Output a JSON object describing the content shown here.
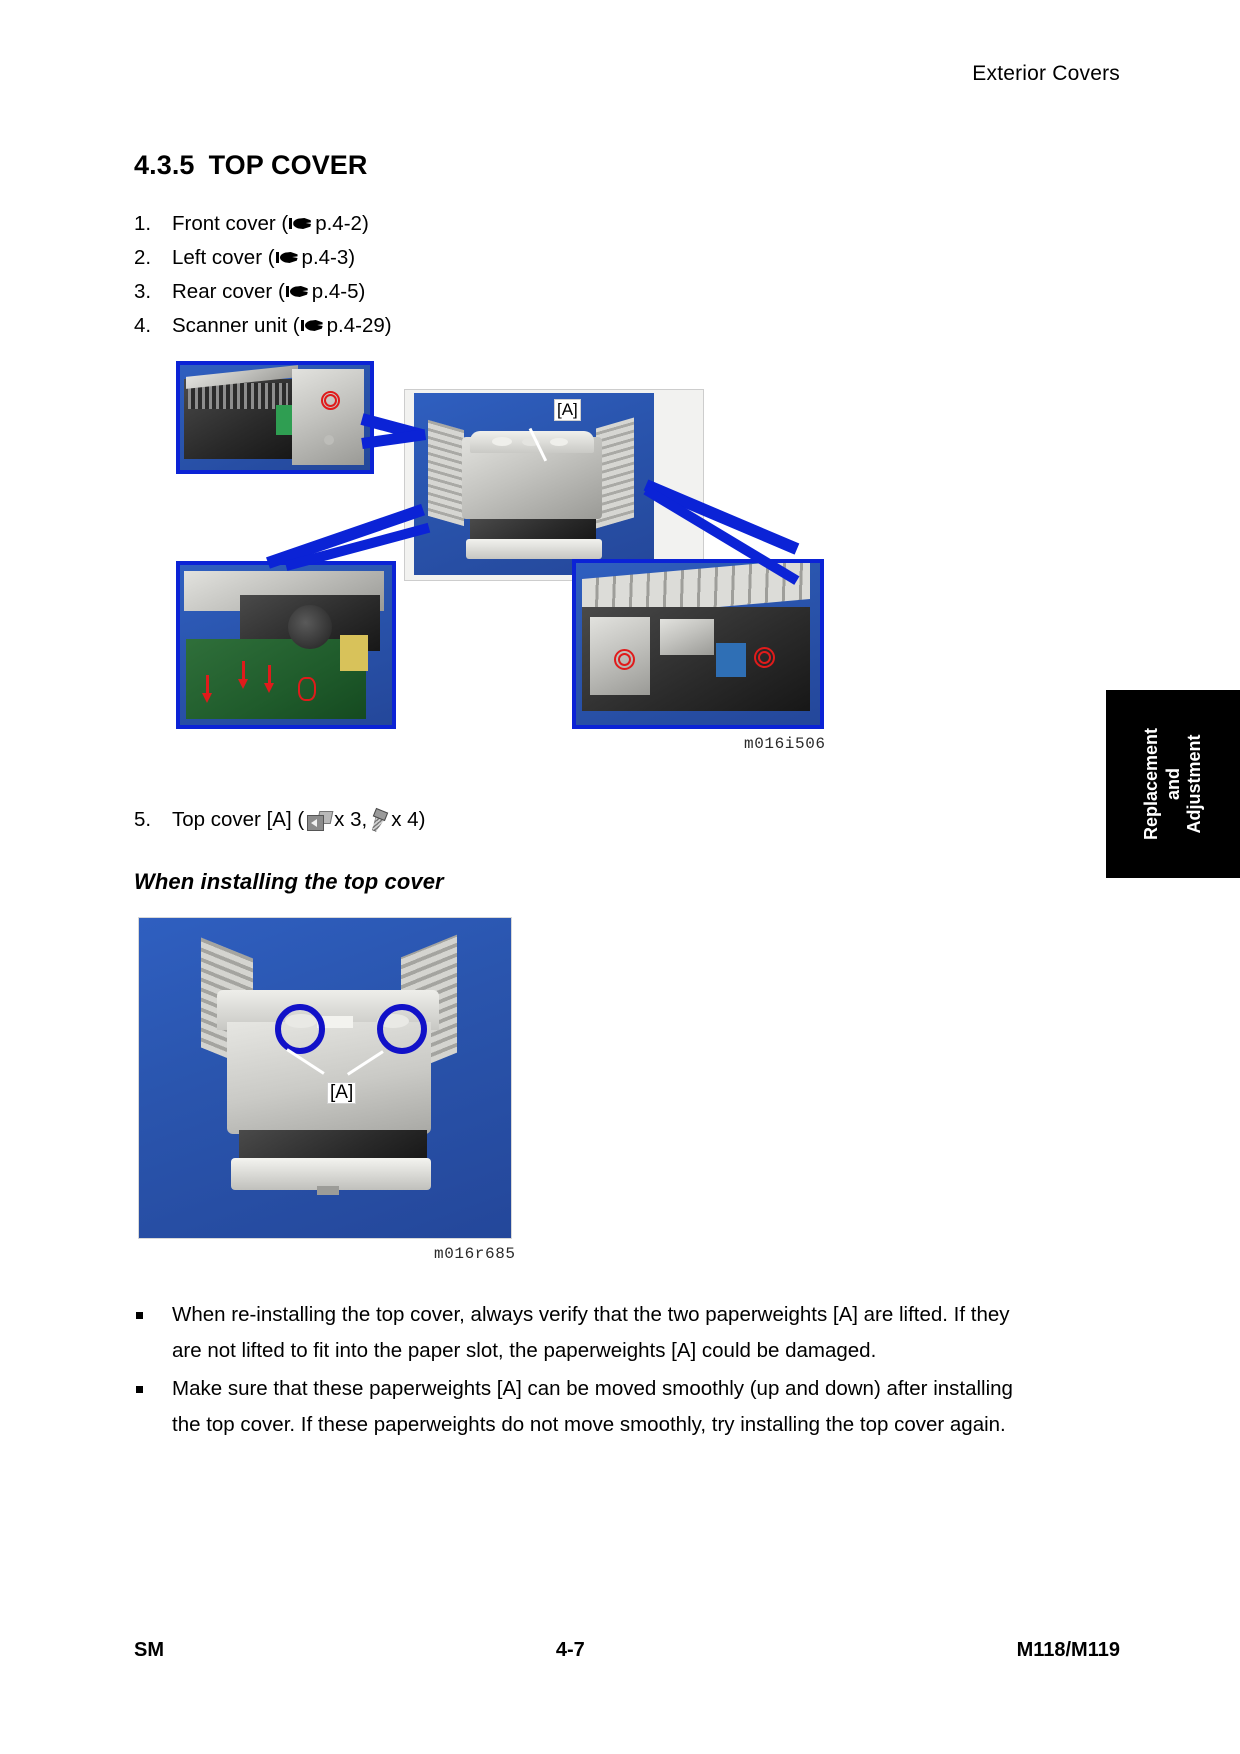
{
  "header": {
    "running_head": "Exterior Covers"
  },
  "side_tab": {
    "line1": "Replacement",
    "line2": "and",
    "line3": "Adjustment"
  },
  "section": {
    "number": "4.3.5",
    "title": "TOP COVER"
  },
  "steps": [
    {
      "num": "1.",
      "text_before": "Front cover (",
      "icon": "hand-pointer-icon",
      "ref": "p.4-2",
      "text_after": ")"
    },
    {
      "num": "2.",
      "text_before": "Left cover (",
      "icon": "hand-pointer-icon",
      "ref": "p.4-3",
      "text_after": ")"
    },
    {
      "num": "3.",
      "text_before": "Rear cover (",
      "icon": "hand-pointer-icon",
      "ref": "p.4-5",
      "text_after": ")"
    },
    {
      "num": "4.",
      "text_before": "Scanner unit (",
      "icon": "hand-pointer-icon",
      "ref": "p.4-29",
      "text_after": ")"
    }
  ],
  "step5": {
    "num": "5.",
    "text_before": "Top cover [A] (",
    "connector_icon": "connector-icon",
    "connector_count": "x 3,",
    "screw_icon": "screw-icon",
    "screw_count": "x 4)"
  },
  "figure1": {
    "caption": "m016i506",
    "callout_label": "[A]"
  },
  "subhead": "When installing the top cover",
  "figure2": {
    "caption": "m016r685",
    "callout_label": "[A]"
  },
  "notes": [
    "When re-installing the top cover, always verify that the two paperweights [A] are lifted. If they are not lifted to fit into the paper slot, the paperweights [A] could be damaged.",
    "Make sure that these paperweights [A] can be moved smoothly (up and down) after installing the top cover. If these paperweights do not move smoothly, try installing the top cover again."
  ],
  "footer": {
    "left": "SM",
    "page": "4-7",
    "right": "M118/M119"
  },
  "colors": {
    "photo_blue": "#24479a",
    "panel_border_blue": "#0b23d6",
    "highlight_red": "#e01b1b",
    "tab_black": "#000000"
  }
}
